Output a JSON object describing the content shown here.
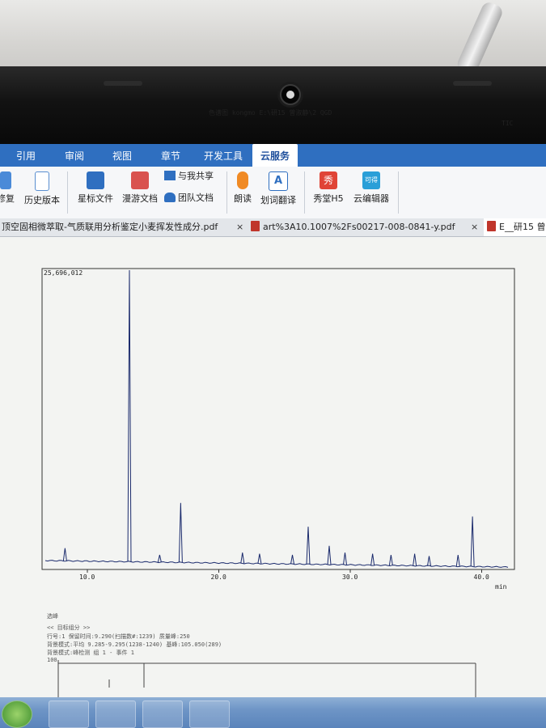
{
  "ribbon_tabs": [
    "引用",
    "审阅",
    "视图",
    "章节",
    "开发工具",
    "云服务"
  ],
  "ribbon_buttons": {
    "repair": "修复",
    "history": "历史版本",
    "starred": "星标文件",
    "roam": "漫游文档",
    "shared": "与我共享",
    "team": "团队文档",
    "read": "朗读",
    "translate": "划词翻译",
    "xiutang": "秀堂H5",
    "cloud_editor": "云编辑器"
  },
  "ribbon_icon_glyphs": {
    "translate": "A",
    "xiutang": "秀",
    "cloud_editor": "可得"
  },
  "doc_tabs": [
    "顶空固相微萃取-气质联用分析鉴定小麦挥发性成分.pdf",
    "art%3A10.1007%2Fs00217-008-0841-y.pdf",
    "E__研15 曾"
  ],
  "close_glyph": "×",
  "document": {
    "header": "色谱图 kongmo E:\\研15 曾淑静\\2 QGD",
    "signal_label": "TIC",
    "bottom_lines": [
      "选峰",
      "<< 目标组分 >>",
      "行号:1 保留时间:9.290(扫描数#:1239) 质量峰:250",
      "背景模式:平均 9.285-9.295(1238-1240) 基峰:105.050(289)",
      "背景模式:峰检测 组 1 - 事件 1"
    ],
    "spectrum_label": "100"
  },
  "chart_data": {
    "type": "line",
    "title": "",
    "xlabel": "",
    "ylabel": "",
    "x_unit": "min",
    "y_max_label": "25,696,012",
    "xlim": [
      6.8,
      42.0
    ],
    "ylim": [
      0,
      25696012
    ],
    "x_ticks": [
      10.0,
      20.0,
      30.0,
      40.0
    ],
    "x_tick_labels": [
      "10.0",
      "20.0",
      "30.0",
      "40.0"
    ],
    "peaks": [
      {
        "rt": 13.2,
        "intensity": 25696012
      },
      {
        "rt": 17.1,
        "intensity": 5100000
      },
      {
        "rt": 26.8,
        "intensity": 3000000
      },
      {
        "rt": 39.3,
        "intensity": 3900000
      },
      {
        "rt": 8.3,
        "intensity": 1100000
      },
      {
        "rt": 28.4,
        "intensity": 1300000
      },
      {
        "rt": 15.5,
        "intensity": 500000
      },
      {
        "rt": 21.8,
        "intensity": 700000
      },
      {
        "rt": 23.1,
        "intensity": 600000
      },
      {
        "rt": 25.6,
        "intensity": 500000
      },
      {
        "rt": 29.6,
        "intensity": 700000
      },
      {
        "rt": 31.7,
        "intensity": 600000
      },
      {
        "rt": 33.1,
        "intensity": 500000
      },
      {
        "rt": 34.9,
        "intensity": 600000
      },
      {
        "rt": 36.0,
        "intensity": 400000
      },
      {
        "rt": 38.2,
        "intensity": 500000
      }
    ]
  },
  "colors": {
    "tab_bar": "#2f6fc0",
    "trace": "#1a2a6c"
  }
}
